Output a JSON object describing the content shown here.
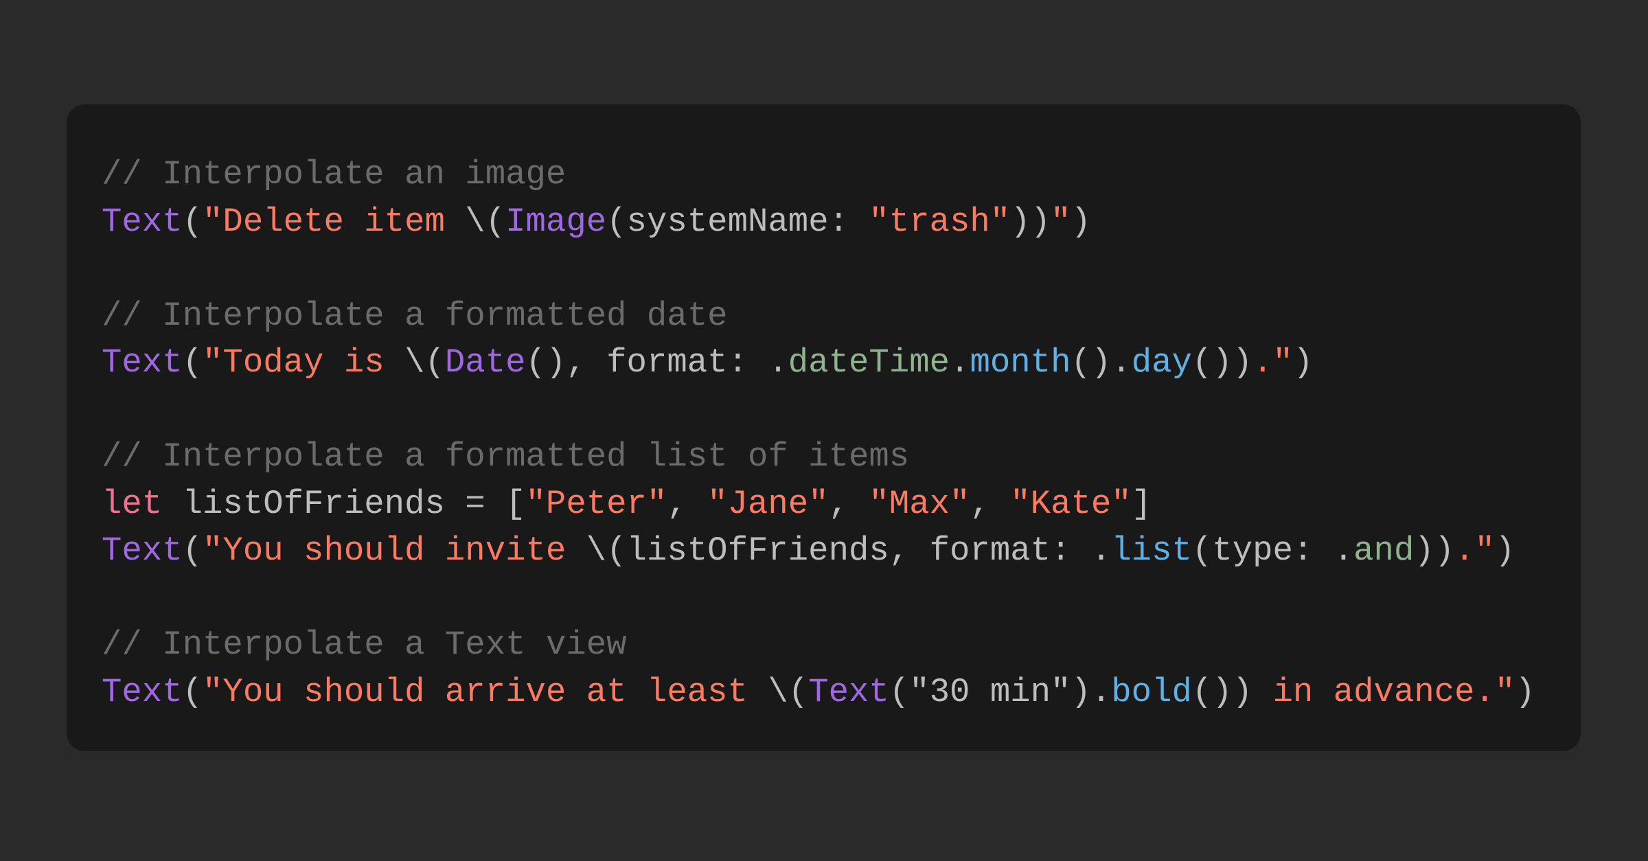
{
  "code_block": {
    "language": "swift",
    "colors": {
      "background": "#2a2a2a",
      "card": "#191919",
      "comment": "#6b6b6b",
      "type": "#a068e0",
      "string": "#fb7a62",
      "keyword": "#f0718c",
      "plain": "#bdbdbd",
      "enum_case": "#8fb38f",
      "method": "#5eb1e6"
    },
    "lines": [
      {
        "tokens": [
          {
            "k": "comment",
            "t": "// Interpolate an image"
          }
        ]
      },
      {
        "tokens": [
          {
            "k": "type",
            "t": "Text"
          },
          {
            "k": "plain",
            "t": "("
          },
          {
            "k": "string",
            "t": "\"Delete item "
          },
          {
            "k": "plain",
            "t": "\\("
          },
          {
            "k": "type",
            "t": "Image"
          },
          {
            "k": "plain",
            "t": "(systemName: "
          },
          {
            "k": "string",
            "t": "\"trash\""
          },
          {
            "k": "plain",
            "t": "))"
          },
          {
            "k": "string",
            "t": "\""
          },
          {
            "k": "plain",
            "t": ")"
          }
        ]
      },
      {
        "tokens": []
      },
      {
        "tokens": [
          {
            "k": "comment",
            "t": "// Interpolate a formatted date"
          }
        ]
      },
      {
        "tokens": [
          {
            "k": "type",
            "t": "Text"
          },
          {
            "k": "plain",
            "t": "("
          },
          {
            "k": "string",
            "t": "\"Today is "
          },
          {
            "k": "plain",
            "t": "\\("
          },
          {
            "k": "type",
            "t": "Date"
          },
          {
            "k": "plain",
            "t": "(), format: ."
          },
          {
            "k": "enum",
            "t": "dateTime"
          },
          {
            "k": "plain",
            "t": "."
          },
          {
            "k": "method",
            "t": "month"
          },
          {
            "k": "plain",
            "t": "()."
          },
          {
            "k": "method",
            "t": "day"
          },
          {
            "k": "plain",
            "t": "())"
          },
          {
            "k": "string",
            "t": ".\""
          },
          {
            "k": "plain",
            "t": ")"
          }
        ]
      },
      {
        "tokens": []
      },
      {
        "tokens": [
          {
            "k": "comment",
            "t": "// Interpolate a formatted list of items"
          }
        ]
      },
      {
        "tokens": [
          {
            "k": "keyword",
            "t": "let"
          },
          {
            "k": "plain",
            "t": " listOfFriends = ["
          },
          {
            "k": "string",
            "t": "\"Peter\""
          },
          {
            "k": "plain",
            "t": ", "
          },
          {
            "k": "string",
            "t": "\"Jane\""
          },
          {
            "k": "plain",
            "t": ", "
          },
          {
            "k": "string",
            "t": "\"Max\""
          },
          {
            "k": "plain",
            "t": ", "
          },
          {
            "k": "string",
            "t": "\"Kate\""
          },
          {
            "k": "plain",
            "t": "]"
          }
        ]
      },
      {
        "tokens": [
          {
            "k": "type",
            "t": "Text"
          },
          {
            "k": "plain",
            "t": "("
          },
          {
            "k": "string",
            "t": "\"You should invite "
          },
          {
            "k": "plain",
            "t": "\\(listOfFriends, format: ."
          },
          {
            "k": "method",
            "t": "list"
          },
          {
            "k": "plain",
            "t": "(type: ."
          },
          {
            "k": "enum",
            "t": "and"
          },
          {
            "k": "plain",
            "t": "))"
          },
          {
            "k": "string",
            "t": ".\""
          },
          {
            "k": "plain",
            "t": ")"
          }
        ]
      },
      {
        "tokens": []
      },
      {
        "tokens": [
          {
            "k": "comment",
            "t": "// Interpolate a Text view"
          }
        ]
      },
      {
        "tokens": [
          {
            "k": "type",
            "t": "Text"
          },
          {
            "k": "plain",
            "t": "("
          },
          {
            "k": "string",
            "t": "\"You should arrive at least "
          },
          {
            "k": "plain",
            "t": "\\("
          },
          {
            "k": "type",
            "t": "Text"
          },
          {
            "k": "plain",
            "t": "(\"30 min\")."
          },
          {
            "k": "method",
            "t": "bold"
          },
          {
            "k": "plain",
            "t": "())"
          },
          {
            "k": "string",
            "t": " in advance.\""
          },
          {
            "k": "plain",
            "t": ")"
          }
        ]
      }
    ]
  }
}
